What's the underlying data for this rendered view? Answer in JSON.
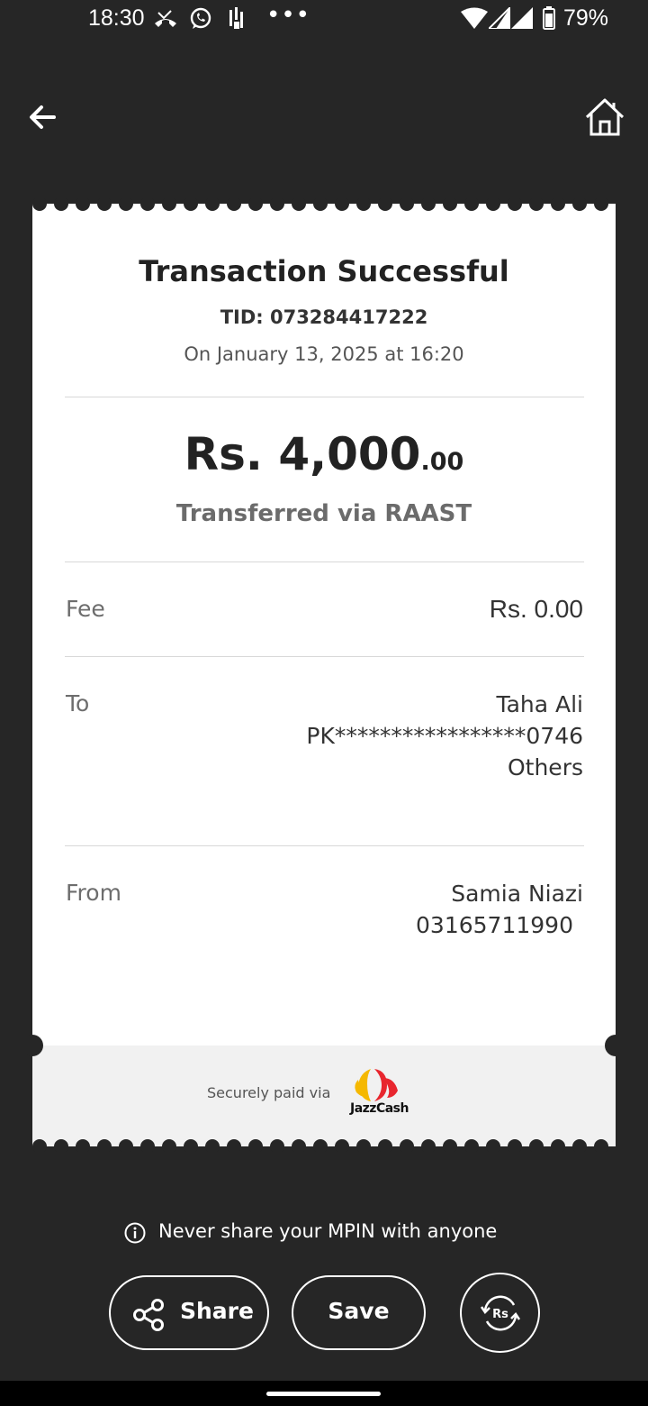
{
  "status_bar": {
    "time": "18:30",
    "dots": "•••",
    "battery_percent": "79%",
    "icons": [
      "missed-call-icon",
      "whatsapp-icon",
      "data-icon",
      "wifi-icon",
      "signal-icon",
      "signal-icon",
      "battery-icon"
    ]
  },
  "header": {
    "back_icon": "back-arrow-icon",
    "home_icon": "home-icon"
  },
  "receipt": {
    "title": "Transaction Successful",
    "tid": "TID: 073284417222",
    "datetime": "On January 13, 2025 at 16:20",
    "amount_main": "Rs. 4,000",
    "amount_cents": ".00",
    "via": "Transferred via RAAST",
    "fee": {
      "label": "Fee",
      "value": "Rs. 0.00"
    },
    "to": {
      "label": "To",
      "name": "Taha Ali",
      "account": "PK*****************0746",
      "bank": "Others"
    },
    "from": {
      "label": "From",
      "name": "Samia Niazi",
      "phone": "03165711990"
    },
    "secure_text": "Securely paid via",
    "brand": "JazzCash"
  },
  "warning": {
    "text": "Never share your MPIN with anyone",
    "icon": "info-icon"
  },
  "actions": {
    "share_label": "Share",
    "save_label": "Save",
    "repeat_icon": "repeat-payment-icon"
  },
  "colors": {
    "background": "#262626",
    "card": "#ffffff",
    "footer_band": "#f1f1f1",
    "brand_yellow": "#f5b800",
    "brand_red": "#e8262e"
  }
}
